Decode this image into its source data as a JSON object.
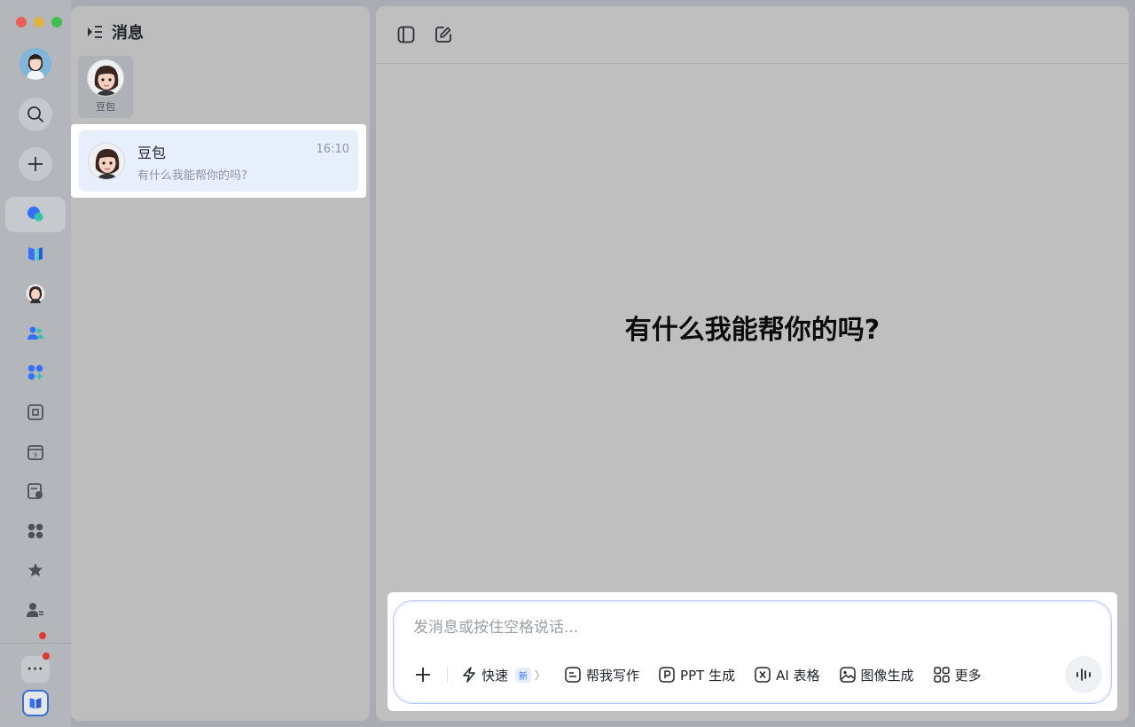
{
  "sidebar": {
    "items": [
      {
        "name": "messages",
        "icon": "chat-bubbles-icon",
        "active": true
      },
      {
        "name": "docs",
        "icon": "book-icon"
      },
      {
        "name": "doubao",
        "icon": "doubao-avatar-icon"
      },
      {
        "name": "contacts",
        "icon": "contacts-icon"
      },
      {
        "name": "workplace",
        "icon": "apps-plus-icon"
      },
      {
        "name": "video-meeting",
        "icon": "meeting-icon"
      },
      {
        "name": "calendar",
        "icon": "calendar-icon",
        "calendar_day": "9"
      },
      {
        "name": "approval",
        "icon": "approval-icon"
      },
      {
        "name": "apps",
        "icon": "grid-icon"
      },
      {
        "name": "favorites",
        "icon": "star-icon"
      },
      {
        "name": "user-settings",
        "icon": "user-gear-icon"
      }
    ],
    "more_label": "···"
  },
  "list_panel": {
    "title": "消息",
    "pinned": {
      "label": "豆包"
    },
    "conversations": [
      {
        "name": "豆包",
        "time": "16:10",
        "preview": "有什么我能帮你的吗?"
      }
    ]
  },
  "main": {
    "welcome": "有什么我能帮你的吗?",
    "input": {
      "placeholder": "发消息或按住空格说话..."
    },
    "tools": [
      {
        "label": "快速",
        "badge": "新",
        "icon": "lightning-icon"
      },
      {
        "label": "帮我写作",
        "icon": "writing-icon"
      },
      {
        "label": "PPT 生成",
        "icon": "ppt-icon"
      },
      {
        "label": "AI 表格",
        "icon": "ai-table-icon"
      },
      {
        "label": "图像生成",
        "icon": "image-icon"
      },
      {
        "label": "更多",
        "icon": "grid-more-icon"
      }
    ]
  },
  "colors": {
    "accent": "#3370ff",
    "selection": "#e7effd"
  }
}
